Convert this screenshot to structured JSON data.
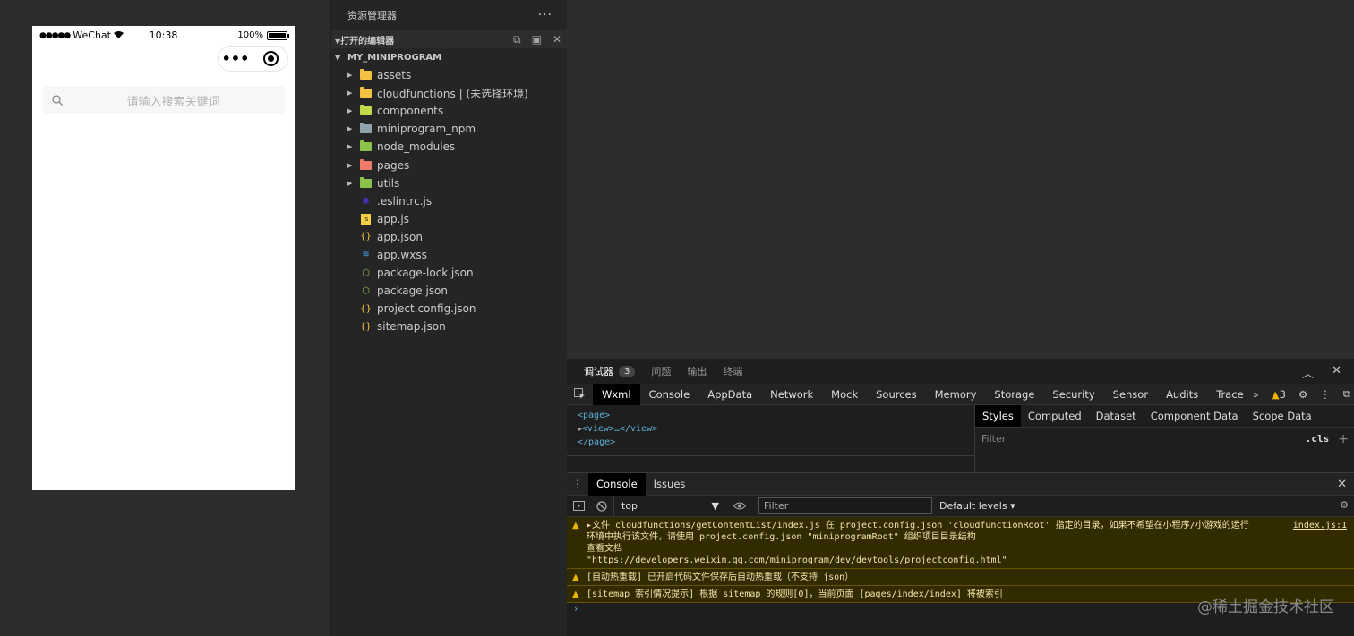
{
  "simulator": {
    "carrier": "WeChat",
    "time": "10:38",
    "battery_text": "100%",
    "battery_level": 1.0,
    "capsule_more": "•••",
    "search_placeholder": "请输入搜索关键词"
  },
  "explorer": {
    "title": "资源管理器",
    "more": "···",
    "open_editors": "打开的编辑器",
    "project": "MY_MINIPROGRAM",
    "items": [
      {
        "label": "assets",
        "kind": "folder",
        "color": "#f5c143"
      },
      {
        "label": "cloudfunctions | (未选择环境)",
        "kind": "folder",
        "color": "#f5c143"
      },
      {
        "label": "components",
        "kind": "folder",
        "color": "#c2d94a"
      },
      {
        "label": "miniprogram_npm",
        "kind": "folder",
        "color": "#90a4ae"
      },
      {
        "label": "node_modules",
        "kind": "folder",
        "color": "#8bc34a"
      },
      {
        "label": "pages",
        "kind": "folder",
        "color": "#ef7b6b"
      },
      {
        "label": "utils",
        "kind": "folder",
        "color": "#8bc34a"
      },
      {
        "label": ".eslintrc.js",
        "kind": "file",
        "icon": "eslint-icon",
        "color": "#4b32c3"
      },
      {
        "label": "app.js",
        "kind": "file",
        "icon": "js-icon",
        "color": "#f5d142"
      },
      {
        "label": "app.json",
        "kind": "file",
        "icon": "json-icon",
        "color": "#f5c143"
      },
      {
        "label": "app.wxss",
        "kind": "file",
        "icon": "css-icon",
        "color": "#42a5f5"
      },
      {
        "label": "package-lock.json",
        "kind": "file",
        "icon": "npm-icon",
        "color": "#8bc34a"
      },
      {
        "label": "package.json",
        "kind": "file",
        "icon": "npm-icon",
        "color": "#8bc34a"
      },
      {
        "label": "project.config.json",
        "kind": "file",
        "icon": "json-icon",
        "color": "#f5c143"
      },
      {
        "label": "sitemap.json",
        "kind": "file",
        "icon": "json-icon",
        "color": "#f5c143"
      }
    ]
  },
  "devtools": {
    "tabs": {
      "debugger": "调试器",
      "debugger_badge": "3",
      "problems": "问题",
      "output": "输出",
      "terminal": "终端"
    },
    "panels": [
      "Wxml",
      "Console",
      "AppData",
      "Network",
      "Mock",
      "Sources",
      "Memory",
      "Storage",
      "Security",
      "Sensor",
      "Audits",
      "Trace"
    ],
    "overflow": "»",
    "warning_count": "3",
    "dom": [
      "<page>",
      "<view>…</view>",
      "</page>"
    ],
    "style_tabs": [
      "Styles",
      "Computed",
      "Dataset",
      "Component Data",
      "Scope Data"
    ],
    "style_filter": "Filter",
    "cls": ".cls",
    "plus": "+",
    "console_tabs": [
      "Console",
      "Issues"
    ],
    "context": "top",
    "filter_placeholder": "Filter",
    "levels": "Default levels ▾",
    "messages": [
      {
        "lines": [
          "▸文件 cloudfunctions/getContentList/index.js 在 project.config.json 'cloudfunctionRoot' 指定的目录，如果不希望在小程序/小游戏的运行",
          "环境中执行该文件，请使用 project.config.json \"miniprogramRoot\" 组织项目目录结构",
          "查看文档"
        ],
        "link": "https://developers.weixin.qq.com/miniprogram/dev/devtools/projectconfig.html",
        "source": "index.js:1"
      },
      {
        "lines": [
          "[自动热重载] 已开启代码文件保存后自动热重载（不支持 json）"
        ]
      },
      {
        "lines": [
          "[sitemap 索引情况提示] 根据 sitemap 的规则[0]，当前页面 [pages/index/index] 将被索引"
        ]
      }
    ],
    "prompt": "›"
  },
  "watermark": "@稀土掘金技术社区"
}
